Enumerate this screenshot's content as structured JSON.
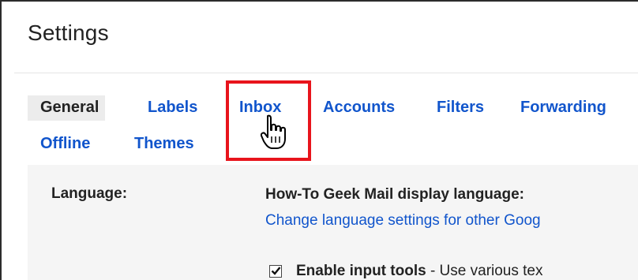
{
  "page": {
    "title": "Settings"
  },
  "tabs": {
    "general": "General",
    "labels": "Labels",
    "inbox": "Inbox",
    "accounts": "Accounts",
    "filters": "Filters",
    "forwarding": "Forwarding",
    "offline": "Offline",
    "themes": "Themes"
  },
  "active_tab": "General",
  "language": {
    "label": "Language:",
    "display_language": "How-To Geek Mail display language:",
    "change_link": "Change language settings for other Goog"
  },
  "input_tools": {
    "checked": true,
    "title": "Enable input tools",
    "description": " - Use various tex"
  },
  "colors": {
    "link": "#1155cc",
    "highlight": "#e8141c",
    "active_tab_bg": "#ececec",
    "panel_bg": "#f5f5f5"
  },
  "icons": {
    "cursor": "hand-pointer-icon",
    "checkbox": "checkmark-icon"
  }
}
